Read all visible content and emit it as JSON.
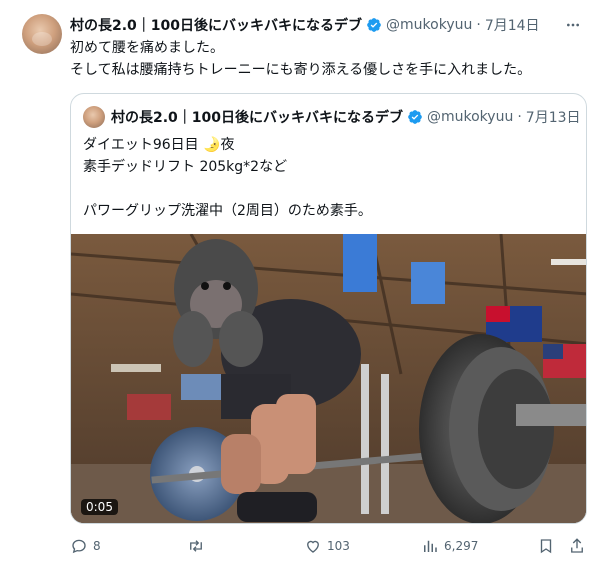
{
  "tweet": {
    "author_name": "村の長2.0｜100日後にバッキバキになるデブ",
    "handle": "@mukokyuu",
    "date": "7月14日",
    "text_lines": [
      "初めて腰を痛めました。",
      "そして私は腰痛持ちトレーニーにも寄り添える優しさを手に入れました。"
    ]
  },
  "quote": {
    "author_name": "村の長2.0｜100日後にバッキバキになるデブ",
    "handle": "@mukokyuu",
    "date": "7月13日",
    "text_lines": [
      "ダイエット96日目 🌛夜",
      "素手デッドリフト 205kg*2など",
      "",
      "パワーグリップ洗濯中（2周目）のため素手。"
    ],
    "video_duration": "0:05"
  },
  "actions": {
    "replies": "8",
    "reposts": "",
    "likes": "103",
    "views": "6,297"
  },
  "colors": {
    "verified": "#1d9bf0",
    "muted_text": "#536471",
    "border": "#cfd9de"
  },
  "icons": [
    "verified-badge-icon",
    "more-icon",
    "reply-icon",
    "repost-icon",
    "like-icon",
    "views-icon",
    "bookmark-icon",
    "share-icon"
  ]
}
